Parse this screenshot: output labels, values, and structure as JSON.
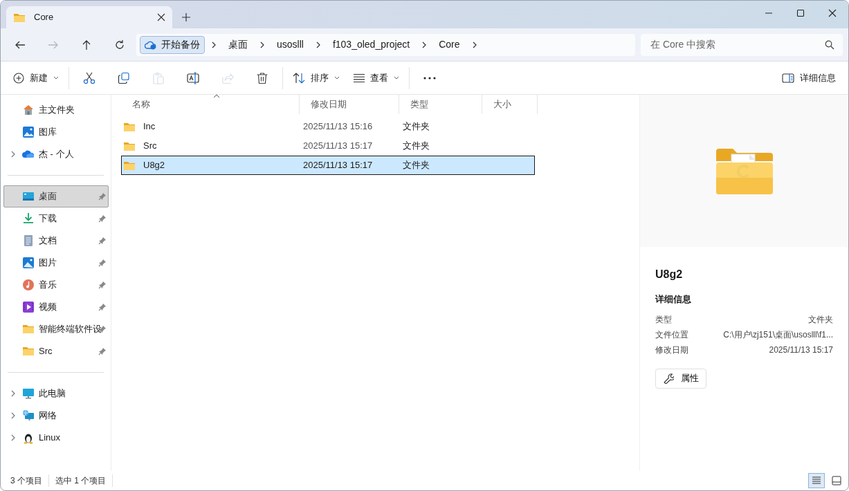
{
  "window": {
    "tabs": [
      {
        "title": "Core",
        "selected": true
      }
    ]
  },
  "navigation": [
    {
      "kind": "back",
      "disabled": false
    },
    {
      "kind": "forward",
      "disabled": true
    },
    {
      "kind": "up",
      "disabled": false
    },
    {
      "kind": "refresh",
      "disabled": false
    }
  ],
  "address_bar": {
    "backup_button": "开始备份",
    "crumbs": [
      "桌面",
      "usoslll",
      "f103_oled_project",
      "Core"
    ]
  },
  "search": {
    "placeholder": "在 Core 中搜索"
  },
  "toolbar": {
    "new": {
      "label": "新建"
    },
    "actions": [
      {
        "kind": "cut",
        "disabled": false
      },
      {
        "kind": "copy",
        "disabled": false
      },
      {
        "kind": "paste",
        "disabled": true
      },
      {
        "kind": "rename",
        "disabled": false
      },
      {
        "kind": "share",
        "disabled": true
      },
      {
        "kind": "delete",
        "disabled": false
      }
    ],
    "sort": {
      "label": "排序"
    },
    "view": {
      "label": "查看"
    },
    "details": {
      "label": "详细信息"
    }
  },
  "sidebar": {
    "groups": [
      {
        "items": [
          {
            "kind": "home",
            "label": "主文件夹",
            "expandable": false,
            "pinned": false,
            "selected": false
          },
          {
            "kind": "gallery",
            "label": "图库",
            "expandable": false,
            "pinned": false,
            "selected": false
          },
          {
            "kind": "cloud",
            "label": "杰 - 个人",
            "expandable": true,
            "pinned": false,
            "selected": false
          }
        ]
      },
      {
        "items": [
          {
            "kind": "desktop",
            "label": "桌面",
            "expandable": false,
            "pinned": true,
            "selected": true
          },
          {
            "kind": "download",
            "label": "下载",
            "expandable": false,
            "pinned": true,
            "selected": false
          },
          {
            "kind": "documents",
            "label": "文档",
            "expandable": false,
            "pinned": true,
            "selected": false
          },
          {
            "kind": "pictures",
            "label": "图片",
            "expandable": false,
            "pinned": true,
            "selected": false
          },
          {
            "kind": "music",
            "label": "音乐",
            "expandable": false,
            "pinned": true,
            "selected": false
          },
          {
            "kind": "videos",
            "label": "视频",
            "expandable": false,
            "pinned": true,
            "selected": false
          },
          {
            "kind": "folder",
            "label": "智能终端软件设",
            "expandable": false,
            "pinned": true,
            "selected": false
          },
          {
            "kind": "folder",
            "label": "Src",
            "expandable": false,
            "pinned": true,
            "selected": false
          }
        ]
      },
      {
        "items": [
          {
            "kind": "pc",
            "label": "此电脑",
            "expandable": true,
            "pinned": false,
            "selected": false
          },
          {
            "kind": "network",
            "label": "网络",
            "expandable": true,
            "pinned": false,
            "selected": false
          },
          {
            "kind": "linux",
            "label": "Linux",
            "expandable": true,
            "pinned": false,
            "selected": false
          }
        ]
      }
    ]
  },
  "table": {
    "columns": [
      {
        "label": "名称",
        "sorted": true
      },
      {
        "label": "修改日期",
        "sorted": false
      },
      {
        "label": "类型",
        "sorted": false
      },
      {
        "label": "大小",
        "sorted": false
      }
    ],
    "rows": [
      {
        "name": "Inc",
        "modified": "2025/11/13 15:16",
        "type": "文件夹",
        "selected": false
      },
      {
        "name": "Src",
        "modified": "2025/11/13 15:17",
        "type": "文件夹",
        "selected": false
      },
      {
        "name": "U8g2",
        "modified": "2025/11/13 15:17",
        "type": "文件夹",
        "selected": true
      }
    ]
  },
  "details_pane": {
    "title": "U8g2",
    "heading": "详细信息",
    "properties": [
      {
        "label": "类型",
        "value": "文件夹"
      },
      {
        "label": "文件位置",
        "value": "C:\\用户\\zj151\\桌面\\usoslll\\f1..."
      },
      {
        "label": "修改日期",
        "value": "2025/11/13 15:17"
      }
    ],
    "button": "属性"
  },
  "status_bar": {
    "count": "3 个项目",
    "selection": "选中 1 个项目",
    "views": [
      {
        "kind": "details",
        "selected": true
      },
      {
        "kind": "tiles",
        "selected": false
      }
    ]
  }
}
